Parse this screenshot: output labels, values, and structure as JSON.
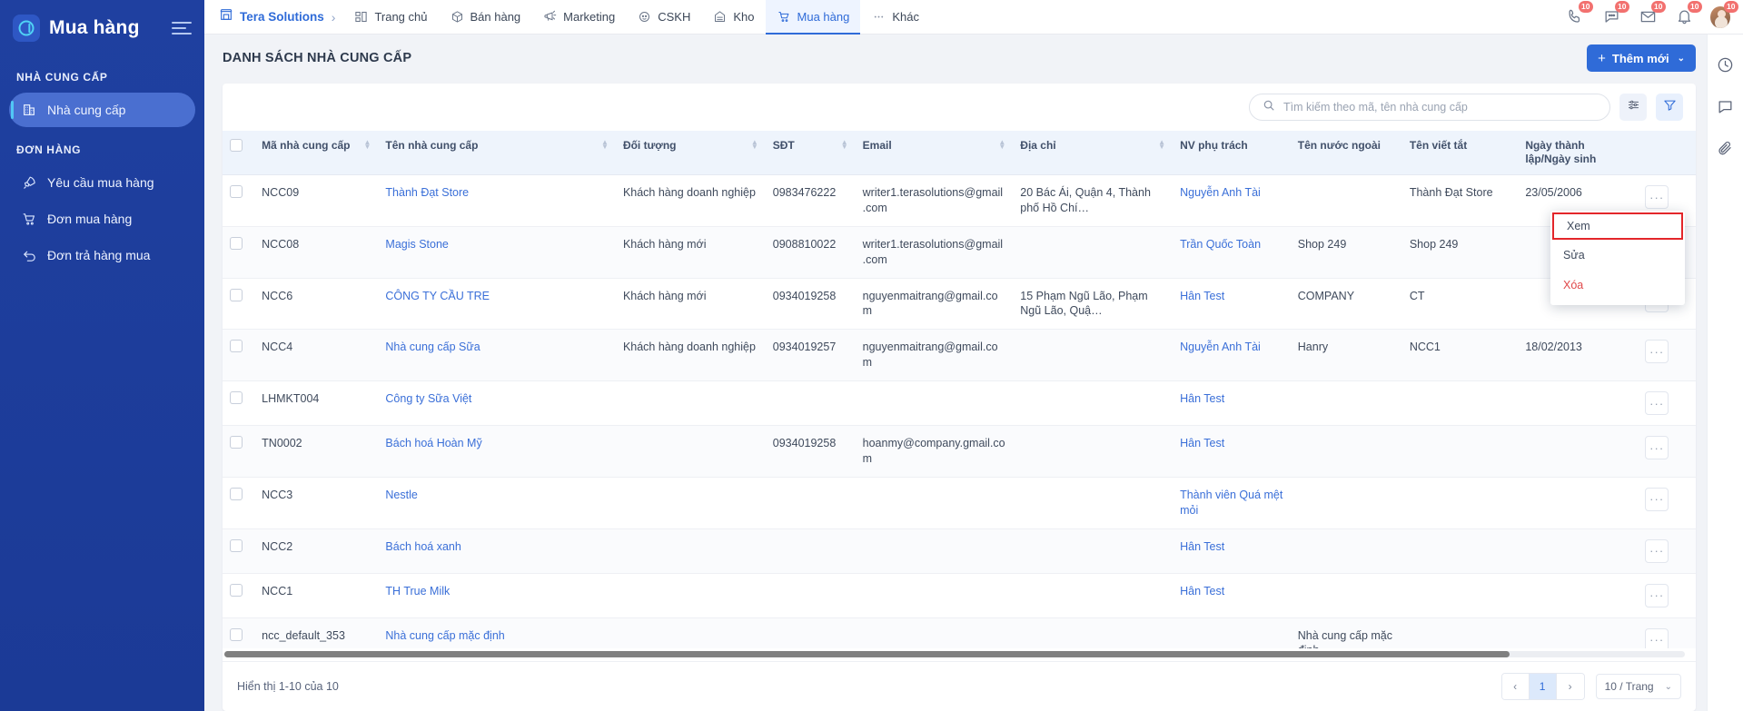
{
  "sidebar": {
    "title": "Mua hàng",
    "groups": [
      {
        "label": "NHÀ CUNG CẤP",
        "items": [
          {
            "label": "Nhà cung cấp",
            "icon": "building-icon",
            "active": true
          }
        ]
      },
      {
        "label": "ĐƠN HÀNG",
        "items": [
          {
            "label": "Yêu cầu mua hàng",
            "icon": "rocket-icon",
            "active": false
          },
          {
            "label": "Đơn mua hàng",
            "icon": "cart-icon",
            "active": false
          },
          {
            "label": "Đơn trả hàng mua",
            "icon": "return-arrow-icon",
            "active": false
          }
        ]
      }
    ]
  },
  "topnav": {
    "brand": "Tera Solutions",
    "separator": "›",
    "items": [
      {
        "label": "Trang chủ",
        "icon": "dashboard-icon",
        "active": false
      },
      {
        "label": "Bán hàng",
        "icon": "box-icon",
        "active": false
      },
      {
        "label": "Marketing",
        "icon": "megaphone-icon",
        "active": false
      },
      {
        "label": "CSKH",
        "icon": "headset-icon",
        "active": false
      },
      {
        "label": "Kho",
        "icon": "warehouse-icon",
        "active": false
      },
      {
        "label": "Mua hàng",
        "icon": "cart-icon",
        "active": true
      },
      {
        "label": "Khác",
        "icon": "ellipsis-icon",
        "active": false
      }
    ],
    "right_icons": [
      {
        "name": "phone-icon",
        "badge": "10"
      },
      {
        "name": "chat-icon",
        "badge": "10"
      },
      {
        "name": "mail-icon",
        "badge": "10"
      },
      {
        "name": "bell-icon",
        "badge": "10"
      },
      {
        "name": "avatar",
        "badge": "10"
      }
    ]
  },
  "rightrail": [
    {
      "name": "clock-icon"
    },
    {
      "name": "comment-icon"
    },
    {
      "name": "attachment-icon"
    }
  ],
  "page": {
    "title": "DANH SÁCH NHÀ CUNG CẤP",
    "add_button": "Thêm mới",
    "add_plus": "+",
    "add_caret": "⌄"
  },
  "toolbar": {
    "search_placeholder": "Tìm kiếm theo mã, tên nhà cung cấp",
    "search_value": "",
    "settings_icon": "sliders-icon",
    "filter_icon": "funnel-icon"
  },
  "table": {
    "columns": [
      {
        "label": "",
        "sortable": false,
        "key": "check"
      },
      {
        "label": "Mã nhà cung cấp",
        "sortable": true
      },
      {
        "label": "Tên nhà cung cấp",
        "sortable": true
      },
      {
        "label": "Đối tượng",
        "sortable": true
      },
      {
        "label": "SĐT",
        "sortable": true
      },
      {
        "label": "Email",
        "sortable": true
      },
      {
        "label": "Địa chỉ",
        "sortable": true
      },
      {
        "label": "NV phụ trách",
        "sortable": false
      },
      {
        "label": "Tên nước ngoài",
        "sortable": false
      },
      {
        "label": "Tên viết tắt",
        "sortable": false
      },
      {
        "label": "Ngày thành lập/Ngày sinh",
        "sortable": false
      },
      {
        "label": "",
        "sortable": false,
        "key": "actions"
      }
    ],
    "rows": [
      {
        "code": "NCC09",
        "name": "Thành Đạt Store",
        "type": "Khách hàng doanh nghiệp",
        "phone": "0983476222",
        "email": "writer1.terasolutions@gmail.com",
        "address": "20 Bác Ái, Quận 4, Thành phố Hồ Chí…",
        "staff": "Nguyễn Anh Tài",
        "foreign_name": "",
        "short_name": "Thành Đạt Store",
        "date": "23/05/2006"
      },
      {
        "code": "NCC08",
        "name": "Magis Stone",
        "type": "Khách hàng mới",
        "phone": "0908810022",
        "email": "writer1.terasolutions@gmail.com",
        "address": "",
        "staff": "Trần Quốc Toàn",
        "foreign_name": "Shop 249",
        "short_name": "Shop 249",
        "date": ""
      },
      {
        "code": "NCC6",
        "name": "CÔNG TY CẦU TRE",
        "type": "Khách hàng mới",
        "phone": "0934019258",
        "email": "nguyenmaitrang@gmail.com",
        "address": "15 Phạm Ngũ Lão, Phạm Ngũ Lão, Quậ…",
        "staff": "Hân Test",
        "foreign_name": "COMPANY",
        "short_name": "CT",
        "date": ""
      },
      {
        "code": "NCC4",
        "name": "Nhà cung cấp Sữa",
        "type": "Khách hàng doanh nghiệp",
        "phone": "0934019257",
        "email": "nguyenmaitrang@gmail.com",
        "address": "",
        "staff": "Nguyễn Anh Tài",
        "foreign_name": "Hanry",
        "short_name": "NCC1",
        "date": "18/02/2013"
      },
      {
        "code": "LHMKT004",
        "name": "Công ty Sữa Việt",
        "type": "",
        "phone": "",
        "email": "",
        "address": "",
        "staff": "Hân Test",
        "foreign_name": "",
        "short_name": "",
        "date": ""
      },
      {
        "code": "TN0002",
        "name": "Bách hoá Hoàn Mỹ",
        "type": "",
        "phone": "0934019258",
        "email": "hoanmy@company.gmail.com",
        "address": "",
        "staff": "Hân Test",
        "foreign_name": "",
        "short_name": "",
        "date": ""
      },
      {
        "code": "NCC3",
        "name": "Nestle",
        "type": "",
        "phone": "",
        "email": "",
        "address": "",
        "staff": "Thành viên Quá mệt mỏi",
        "foreign_name": "",
        "short_name": "",
        "date": ""
      },
      {
        "code": "NCC2",
        "name": "Bách hoá xanh",
        "type": "",
        "phone": "",
        "email": "",
        "address": "",
        "staff": "Hân Test",
        "foreign_name": "",
        "short_name": "",
        "date": ""
      },
      {
        "code": "NCC1",
        "name": "TH True Milk",
        "type": "",
        "phone": "",
        "email": "",
        "address": "",
        "staff": "Hân Test",
        "foreign_name": "",
        "short_name": "",
        "date": ""
      },
      {
        "code": "ncc_default_353",
        "name": "Nhà cung cấp mặc định",
        "type": "",
        "phone": "",
        "email": "",
        "address": "",
        "staff": "",
        "foreign_name": "Nhà cung cấp mặc định",
        "short_name": "",
        "date": ""
      }
    ],
    "action_dots": "···"
  },
  "context_menu": {
    "items": [
      {
        "label": "Xem",
        "selected": true,
        "danger": false
      },
      {
        "label": "Sửa",
        "selected": false,
        "danger": false
      },
      {
        "label": "Xóa",
        "selected": false,
        "danger": true
      }
    ]
  },
  "footer": {
    "showing": "Hiển thị 1-10 của 10",
    "prev": "‹",
    "page": "1",
    "next": "›",
    "per_page": "10 / Trang",
    "per_page_caret": "⌄"
  },
  "colors": {
    "accent": "#2f6bd8",
    "sidebar": "#1e3f9e",
    "link": "#3a6fd8",
    "danger": "#e0484a",
    "badge": "#f2716f",
    "header_row": "#eef4fc"
  }
}
